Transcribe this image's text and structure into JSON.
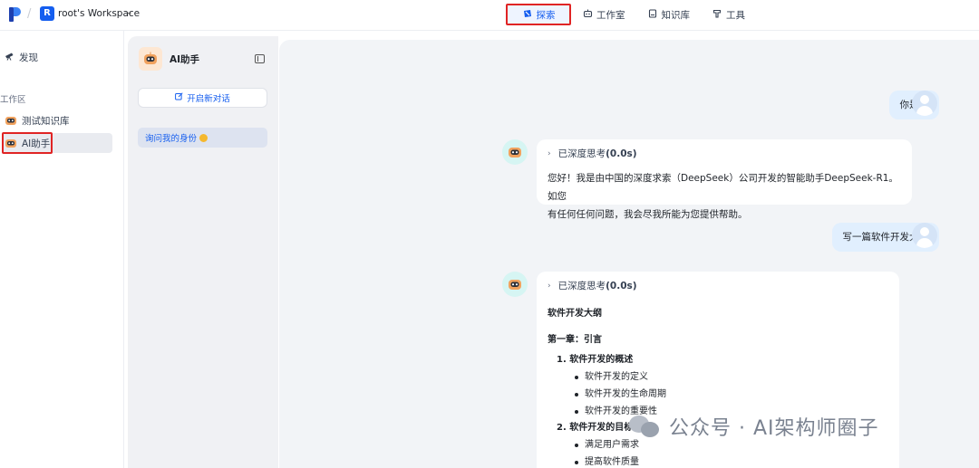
{
  "header": {
    "workspace_badge": "R",
    "workspace_name": "root's Workspace",
    "workspace_caret": "⌄",
    "nav": [
      {
        "label": "探索",
        "icon": "compass-icon",
        "active": true
      },
      {
        "label": "工作室",
        "icon": "robot-icon",
        "active": false
      },
      {
        "label": "知识库",
        "icon": "book-icon",
        "active": false
      },
      {
        "label": "工具",
        "icon": "hammer-icon",
        "active": false
      }
    ]
  },
  "sidebar": {
    "discover_label": "发现",
    "section_label": "工作区",
    "items": [
      {
        "label": "测试知识库"
      },
      {
        "label": "AI助手"
      }
    ]
  },
  "conversations": {
    "app_name": "AI助手",
    "new_chat_label": "开启新对话",
    "items": [
      {
        "label": "询问我的身份"
      }
    ]
  },
  "chat": {
    "messages": [
      {
        "role": "user",
        "text": "你是谁"
      },
      {
        "role": "bot",
        "think_label": "已深度思考",
        "think_time": "(0.0s)",
        "line1": "您好！我是由中国的深度求索（DeepSeek）公司开发的智能助手DeepSeek-R1。如您",
        "line2": "有任何任何问题，我会尽我所能为您提供帮助。"
      },
      {
        "role": "user",
        "text": "写一篇软件开发大纲"
      },
      {
        "role": "bot",
        "think_label": "已深度思考",
        "think_time": "(0.0s)",
        "doc_title": "软件开发大纲",
        "chapter": "第一章：引言",
        "sections": [
          {
            "title": "1. 软件开发的概述",
            "items": [
              "软件开发的定义",
              "软件开发的生命周期",
              "软件开发的重要性"
            ]
          },
          {
            "title": "2. 软件开发的目标",
            "items": [
              "满足用户需求",
              "提高软件质量"
            ]
          }
        ]
      }
    ]
  },
  "watermark": {
    "text": "公众号 · AI架构师圈子"
  },
  "colors": {
    "accent": "#155eef",
    "highlight_border": "#e02424",
    "user_bubble": "#e1effe",
    "main_bg": "#f2f4f7"
  }
}
